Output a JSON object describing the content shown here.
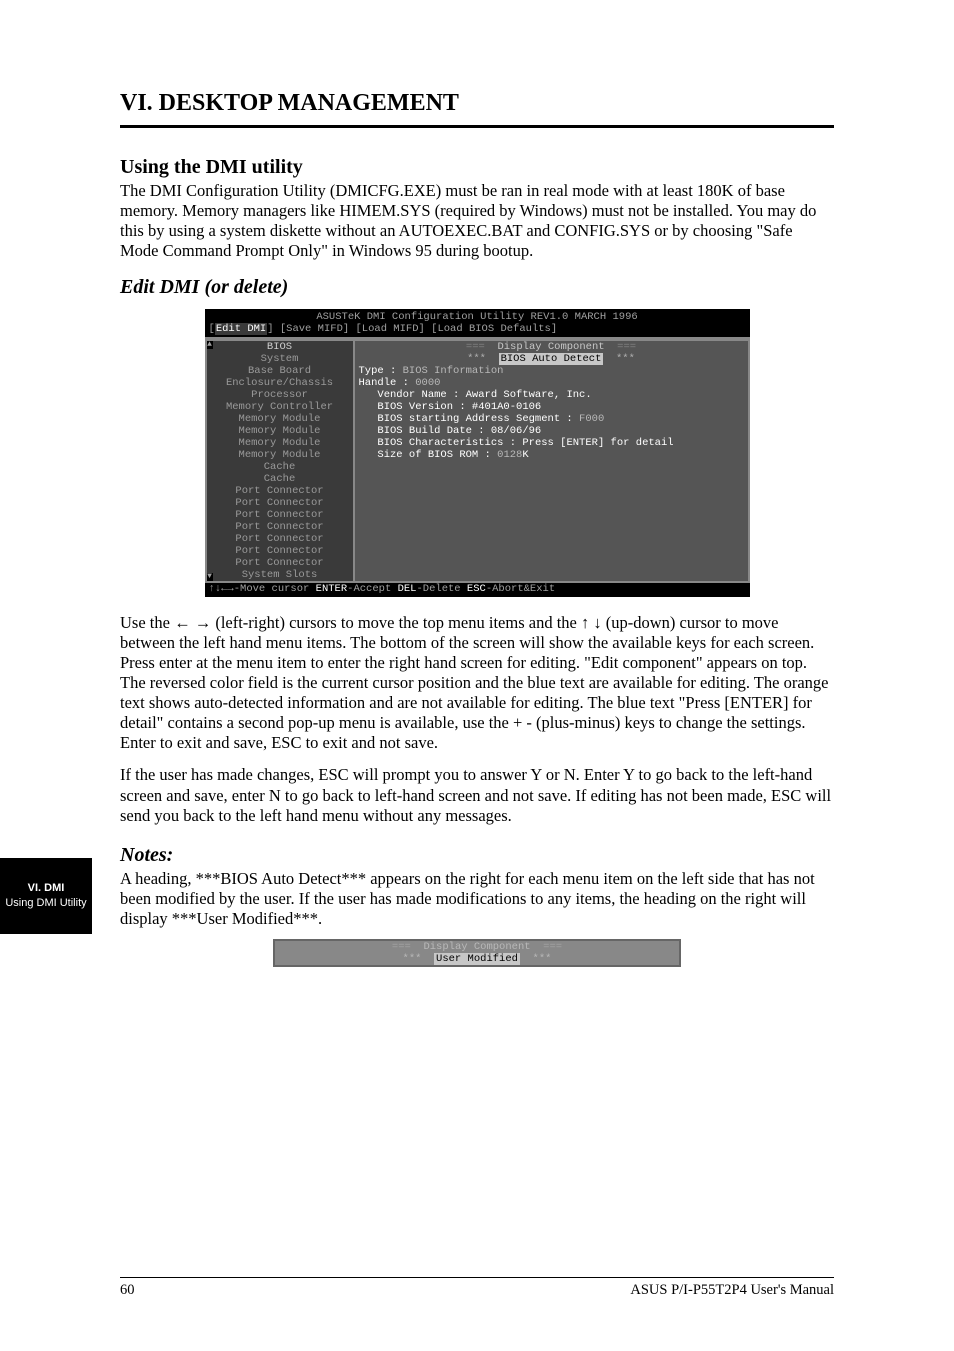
{
  "header": {
    "section_title": "VI. DESKTOP MANAGEMENT",
    "subhead": "Using the DMI utility",
    "intro": "The DMI Configuration Utility (DMICFG.EXE) must be ran in real mode with at least 180K of base memory.  Memory managers like HIMEM.SYS (required by Windows) must not be installed.  You may do this by using a system diskette without an AUTOEXEC.BAT and CONFIG.SYS or by choosing \"Safe Mode Command Prompt Only\" in Windows 95 during bootup."
  },
  "edit_section": {
    "title": "Edit DMI (or delete)"
  },
  "dos": {
    "title": "ASUSTeK DMI Configuration Utility  REV1.0   MARCH 1996",
    "menu": {
      "items": [
        "Edit DMI",
        "Save MIFD",
        "Load MIFD",
        "Load BIOS Defaults"
      ],
      "selected_index": 0
    },
    "left_items": [
      "BIOS",
      "System",
      "Base Board",
      "Enclosure/Chassis",
      "Processor",
      "Memory Controller",
      "Memory Module",
      "Memory Module",
      "Memory Module",
      "Memory Module",
      "Cache",
      "Cache",
      "Port Connector",
      "Port Connector",
      "Port Connector",
      "Port Connector",
      "Port Connector",
      "Port Connector",
      "Port Connector",
      "System Slots"
    ],
    "left_selected_index": 0,
    "right": {
      "display_header": "Display Component",
      "autodetect": "BIOS Auto Detect",
      "type_label": "Type : ",
      "type_value": "BIOS Information",
      "handle_label": "Handle : ",
      "handle_value": "0000",
      "vendor_label": "Vendor Name : ",
      "vendor_value": "Award Software, Inc.",
      "biosver_label": "BIOS Version : ",
      "biosver_value": "#401A0-0106",
      "seg_label": "BIOS starting Address Segment : ",
      "seg_value": "F000",
      "build_label": "BIOS Build Date : ",
      "build_value": "08/06/96",
      "char_label": "BIOS Characteristics : ",
      "char_value": "Press [ENTER] for detail",
      "romsize_label": "Size of BIOS ROM : ",
      "romsize_value": "0128",
      "romsize_unit": "K"
    },
    "status_parts": {
      "a": "↑↓←→",
      "b": "-Move cursor ",
      "c": "ENTER",
      "d": "-Accept ",
      "e": "DEL",
      "f": "-Delete ",
      "g": "ESC",
      "h": "-Abort&Exit"
    }
  },
  "paras": {
    "p1": "Use the ← → (left-right) cursors to move the top menu items and the ↑ ↓ (up-down) cursor to move between the left hand menu items.  The bottom of the screen will show the available keys for each screen.  Press enter at the menu item to enter the right hand screen for editing.  \"Edit component\" appears on top.  The reversed color field is the current cursor position and the blue text are available for editing.  The orange text shows auto-detected information and are not available for editing.  The blue text \"Press [ENTER] for detail\" contains a second pop-up menu is available, use the + - (plus-minus) keys to change the settings.  Enter to exit and save, ESC to exit and not save.",
    "p2": "If the user has made changes, ESC will prompt you to answer Y or N.  Enter Y to go back to the left-hand screen and save, enter N to go back to left-hand screen and not save.  If editing has not been made, ESC will send you back to the left hand menu without any messages."
  },
  "notes_section": {
    "title": "Notes:",
    "body": "A heading, ***BIOS Auto Detect*** appears on the right for each menu item on the left side that has not been modified by the user.  If the user has made modifications to any items, the heading on the right will display ***User Modified***."
  },
  "banner": {
    "header": "Display Component",
    "label": "User Modified"
  },
  "side_tab": {
    "roman": "VI. DMI",
    "sub": "Using DMI Utility"
  },
  "footer": {
    "page": "60",
    "doc": "ASUS P/I-P55T2P4 User's Manual"
  }
}
